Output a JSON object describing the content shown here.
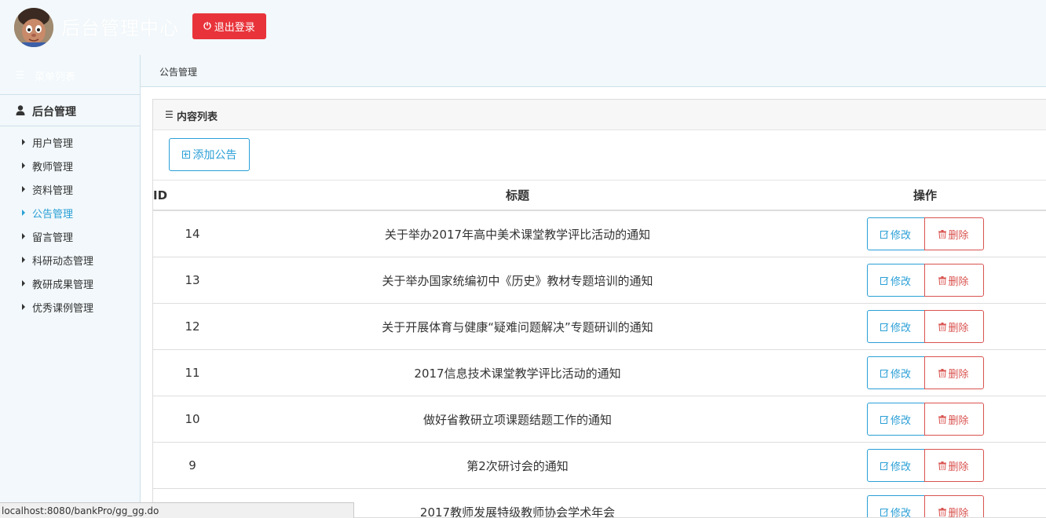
{
  "header": {
    "app_title": "后台管理中心",
    "logout_label": "退出登录",
    "avatar_icon": "cartoon-avatar-icon"
  },
  "sidebar": {
    "menu_list_label": "菜单列表",
    "group_label": "后台管理",
    "items": [
      {
        "label": "用户管理",
        "active": false
      },
      {
        "label": "教师管理",
        "active": false
      },
      {
        "label": "资料管理",
        "active": false
      },
      {
        "label": "公告管理",
        "active": true
      },
      {
        "label": "留言管理",
        "active": false
      },
      {
        "label": " 科研动态管理",
        "active": false
      },
      {
        "label": "教研成果管理",
        "active": false
      },
      {
        "label": "优秀课例管理",
        "active": false
      }
    ]
  },
  "breadcrumb": {
    "current": "公告管理"
  },
  "panel": {
    "title": "内容列表",
    "add_label": "添加公告",
    "columns": {
      "id": "ID",
      "title": "标题",
      "ops": "操作"
    },
    "edit_label": "修改",
    "delete_label": "删除",
    "rows": [
      {
        "id": "14",
        "title": "关于举办2017年高中美术课堂教学评比活动的通知"
      },
      {
        "id": "13",
        "title": "关于举办国家统编初中《历史》教材专题培训的通知"
      },
      {
        "id": "12",
        "title": "关于开展体育与健康“疑难问题解决”专题研训的通知"
      },
      {
        "id": "11",
        "title": "2017信息技术课堂教学评比活动的通知"
      },
      {
        "id": "10",
        "title": "做好省教研立项课题结题工作的通知"
      },
      {
        "id": "9",
        "title": "第2次研讨会的通知"
      },
      {
        "id": "",
        "title": "2017教师发展特级教师协会学术年会"
      }
    ]
  },
  "statusbar": {
    "url": "localhost:8080/bankPro/gg_gg.do"
  },
  "colors": {
    "accent": "#2a9fd6",
    "danger": "#d9534f",
    "logout_bg": "#e8333a",
    "page_bg": "#f2f8fb"
  }
}
